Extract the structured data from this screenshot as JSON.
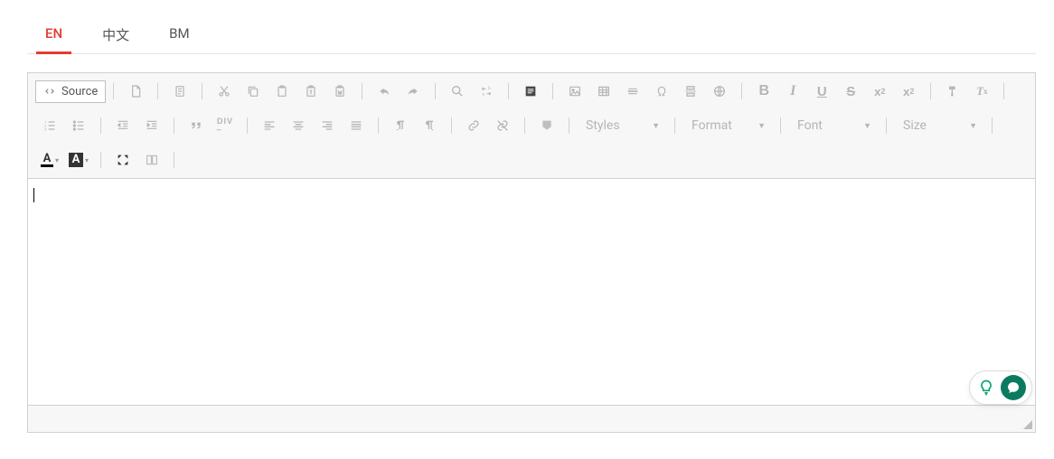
{
  "tabs": {
    "en": "EN",
    "zh": "中文",
    "bm": "BM",
    "active": "en"
  },
  "source_button": "Source",
  "combos": {
    "styles": "Styles",
    "format": "Format",
    "font": "Font",
    "size": "Size"
  },
  "icons": {
    "source": "source",
    "newpage": "new-page",
    "templates": "templates",
    "cut": "cut",
    "copy": "copy",
    "paste": "paste",
    "paste_text": "paste-text",
    "paste_word": "paste-word",
    "undo": "undo",
    "redo": "redo",
    "find": "find",
    "replace": "replace",
    "selectall": "select-all",
    "image": "image",
    "table": "table",
    "hr": "hr",
    "specialchar": "special-char",
    "pagebreak": "page-break",
    "iframe": "iframe",
    "bold": "bold",
    "italic": "italic",
    "underline": "underline",
    "strike": "strike",
    "sub": "subscript",
    "sup": "superscript",
    "format_paint": "format-painter",
    "remove_format": "remove-format",
    "ol": "ordered-list",
    "ul": "bullet-list",
    "outdent": "outdent",
    "indent": "indent",
    "quote": "blockquote",
    "div": "div-container",
    "align_l": "align-left",
    "align_c": "align-center",
    "align_r": "align-right",
    "align_j": "align-justify",
    "ltr": "ltr",
    "rtl": "rtl",
    "link": "link",
    "unlink": "unlink",
    "anchor": "anchor",
    "textcolor": "text-color",
    "bgcolor": "bg-color",
    "maximize": "maximize",
    "blocks": "show-blocks"
  },
  "editor": {
    "content": ""
  }
}
